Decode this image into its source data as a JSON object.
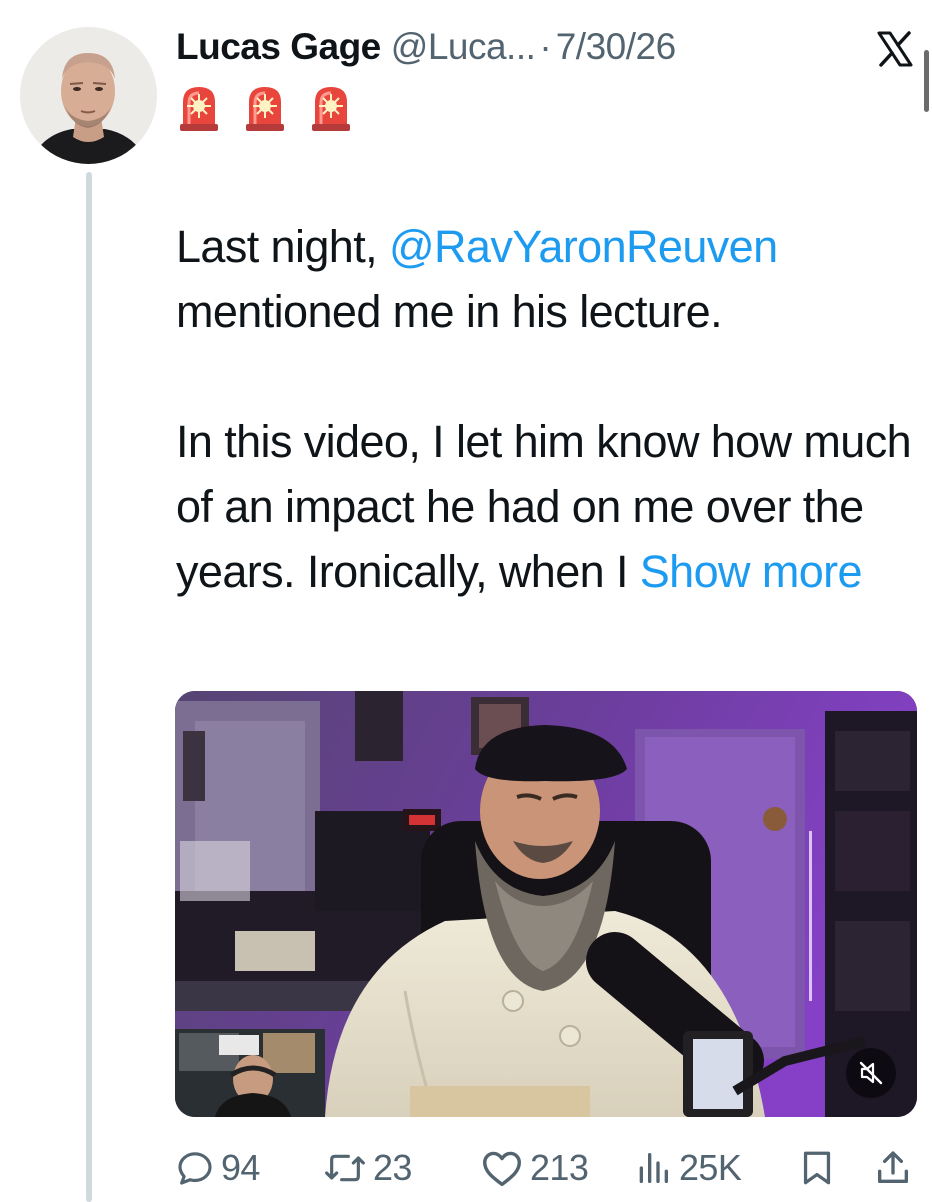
{
  "post": {
    "author_name": "Lucas Gage",
    "handle": "@Luca...",
    "separator": "·",
    "date": "7/30/26",
    "emoji": [
      "siren",
      "siren",
      "siren"
    ],
    "text": {
      "line1_prefix": "Last night, ",
      "mention": "@RavYaronReuven",
      "line1_suffix": " mentioned me in his lecture.",
      "para2": "In this video, I let him know how much of an impact he had on me over the years. Ironically, when I ",
      "show_more": "Show more"
    }
  },
  "video": {
    "muted": true,
    "mute_icon": "speaker-muted-icon"
  },
  "metrics": {
    "replies": "94",
    "reposts": "23",
    "likes": "213",
    "views": "25K"
  },
  "colors": {
    "link": "#1d9bf0",
    "secondary_text": "#536471",
    "thread_line": "#cfd9de"
  }
}
